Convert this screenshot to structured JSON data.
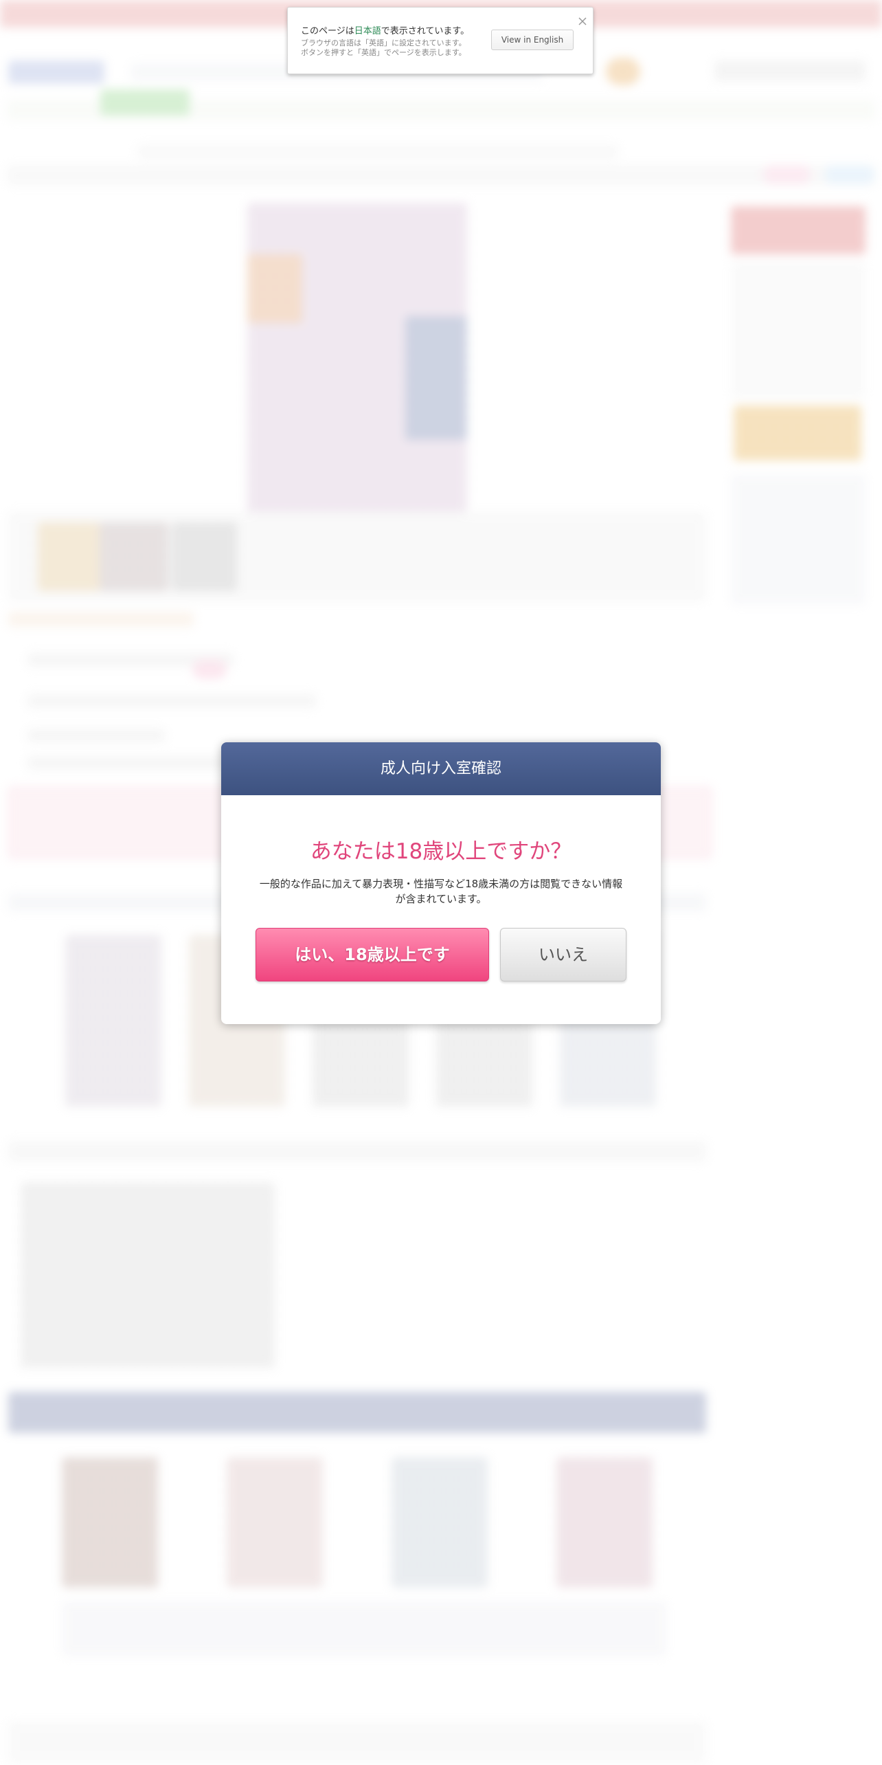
{
  "translate_bar": {
    "prefix": "このページは",
    "language": "日本語",
    "suffix": "で表示されています。",
    "note_line1": "ブラウザの言語は「英語」に設定されています。",
    "note_line2": "ボタンを押すと「英語」でページを表示します。",
    "view_button": "View in English",
    "close_icon": "close-icon"
  },
  "age_modal": {
    "title": "成人向け入室確認",
    "question": "あなたは18歳以上ですか？",
    "description": "一般的な作品に加えて暴力表現・性描写など18歳未満の方は閲覧できない情報が含まれています。",
    "yes_button": "はい、18歳以上です",
    "no_button": "いいえ"
  },
  "colors": {
    "modal_header": "#46598a",
    "question_pink": "#e0457b",
    "yes_button": "#f0457f",
    "language_green": "#2e8b57"
  }
}
